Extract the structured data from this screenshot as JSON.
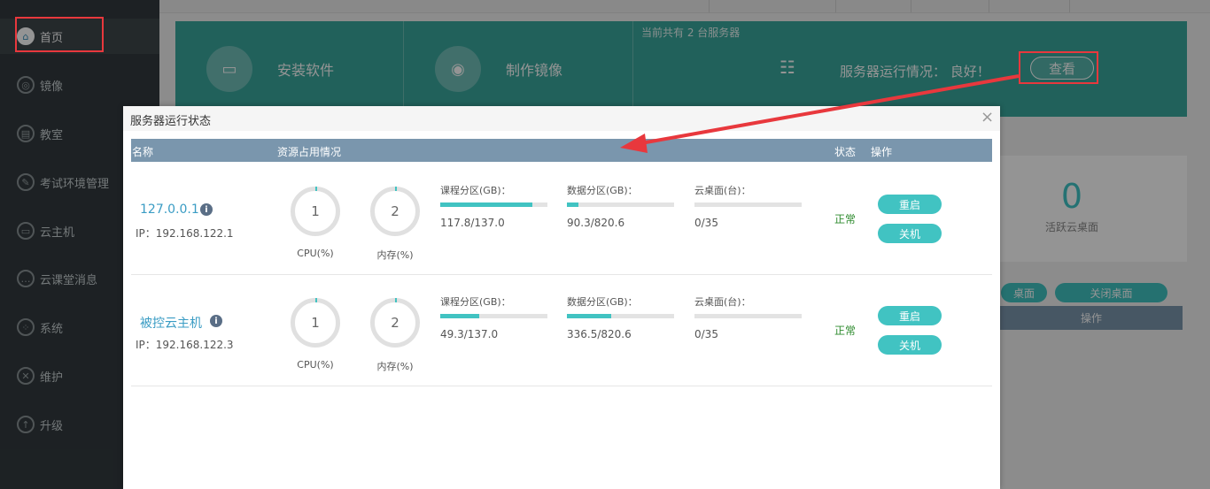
{
  "sidebar": {
    "items": [
      {
        "label": "首页",
        "icon": "home-icon"
      },
      {
        "label": "镜像",
        "icon": "image-icon"
      },
      {
        "label": "教室",
        "icon": "classroom-icon"
      },
      {
        "label": "考试环境管理",
        "icon": "exam-icon"
      },
      {
        "label": "云主机",
        "icon": "cloud-host-icon"
      },
      {
        "label": "云课堂消息",
        "icon": "message-icon"
      },
      {
        "label": "系统",
        "icon": "system-icon"
      },
      {
        "label": "维护",
        "icon": "maintenance-icon"
      },
      {
        "label": "升级",
        "icon": "upgrade-icon"
      }
    ]
  },
  "dashboard": {
    "install_label": "安装软件",
    "image_label": "制作镜像",
    "server_count": "当前共有 2 台服务器",
    "server_status": "服务器运行情况： 良好！",
    "view_label": "查看"
  },
  "background": {
    "active_count": "0",
    "active_label": "活跃云桌面",
    "btn1": "桌面",
    "btn2": "关闭桌面",
    "header_op": "操作"
  },
  "modal": {
    "title": "服务器运行状态",
    "close": "×",
    "headers": {
      "name": "名称",
      "usage": "资源占用情况",
      "status": "状态",
      "actions": "操作"
    },
    "rows": [
      {
        "name": "127.0.0.1",
        "ip": "IP：192.168.122.1",
        "cpu": "1",
        "cpu_label": "CPU(%)",
        "mem": "2",
        "mem_label": "内存(%)",
        "course_label": "课程分区(GB)：",
        "course_value": "117.8/137.0",
        "course_fraction": 0.86,
        "data_label": "数据分区(GB)：",
        "data_value": "90.3/820.6",
        "data_fraction": 0.11,
        "desk_label": "云桌面(台)：",
        "desk_value": "0/35",
        "desk_fraction": 0,
        "status": "正常",
        "restart": "重启",
        "shutdown": "关机"
      },
      {
        "name": "被控云主机",
        "ip": "IP：192.168.122.3",
        "cpu": "1",
        "cpu_label": "CPU(%)",
        "mem": "2",
        "mem_label": "内存(%)",
        "course_label": "课程分区(GB)：",
        "course_value": "49.3/137.0",
        "course_fraction": 0.36,
        "data_label": "数据分区(GB)：",
        "data_value": "336.5/820.6",
        "data_fraction": 0.41,
        "desk_label": "云桌面(台)：",
        "desk_value": "0/35",
        "desk_fraction": 0,
        "status": "正常",
        "restart": "重启",
        "shutdown": "关机"
      }
    ]
  },
  "colors": {
    "accent": "#41c3c2",
    "highlight": "#e8383d",
    "header": "#7a96ad"
  }
}
